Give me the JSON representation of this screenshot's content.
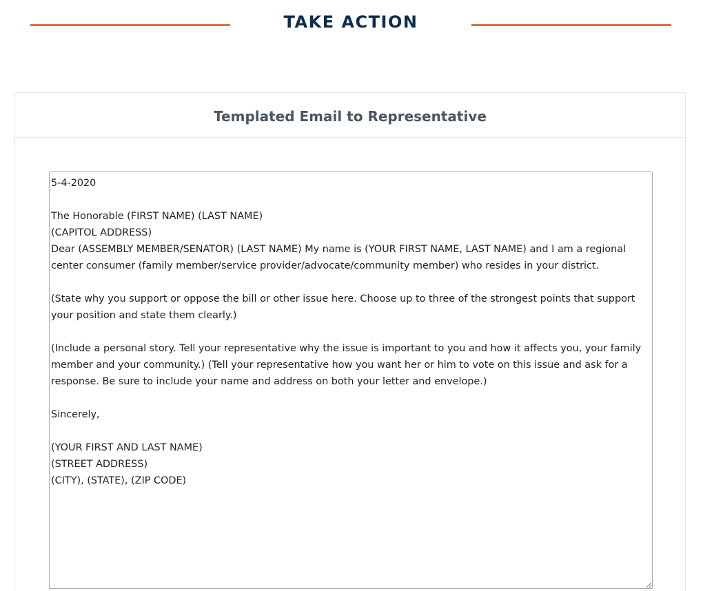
{
  "header": {
    "title": "TAKE ACTION",
    "accent_color": "#e06c45",
    "title_color": "#0f2c4a"
  },
  "card": {
    "title": "Templated Email to Representative"
  },
  "email": {
    "body": "5-4-2020\n\nThe Honorable (FIRST NAME) (LAST NAME)\n(CAPITOL ADDRESS)\nDear (ASSEMBLY MEMBER/SENATOR) (LAST NAME) My name is (YOUR FIRST NAME, LAST NAME) and I am a regional center consumer (family member/service provider/advocate/community member) who resides in your district.\n\n(State why you support or oppose the bill or other issue here. Choose up to three of the strongest points that support your position and state them clearly.)\n\n(Include a personal story. Tell your representative why the issue is important to you and how it affects you, your family member and your community.) (Tell your representative how you want her or him to vote on this issue and ask for a response. Be sure to include your name and address on both your letter and envelope.)\n\nSincerely,\n\n(YOUR FIRST AND LAST NAME)\n(STREET ADDRESS)\n(CITY), (STATE), (ZIP CODE)"
  }
}
